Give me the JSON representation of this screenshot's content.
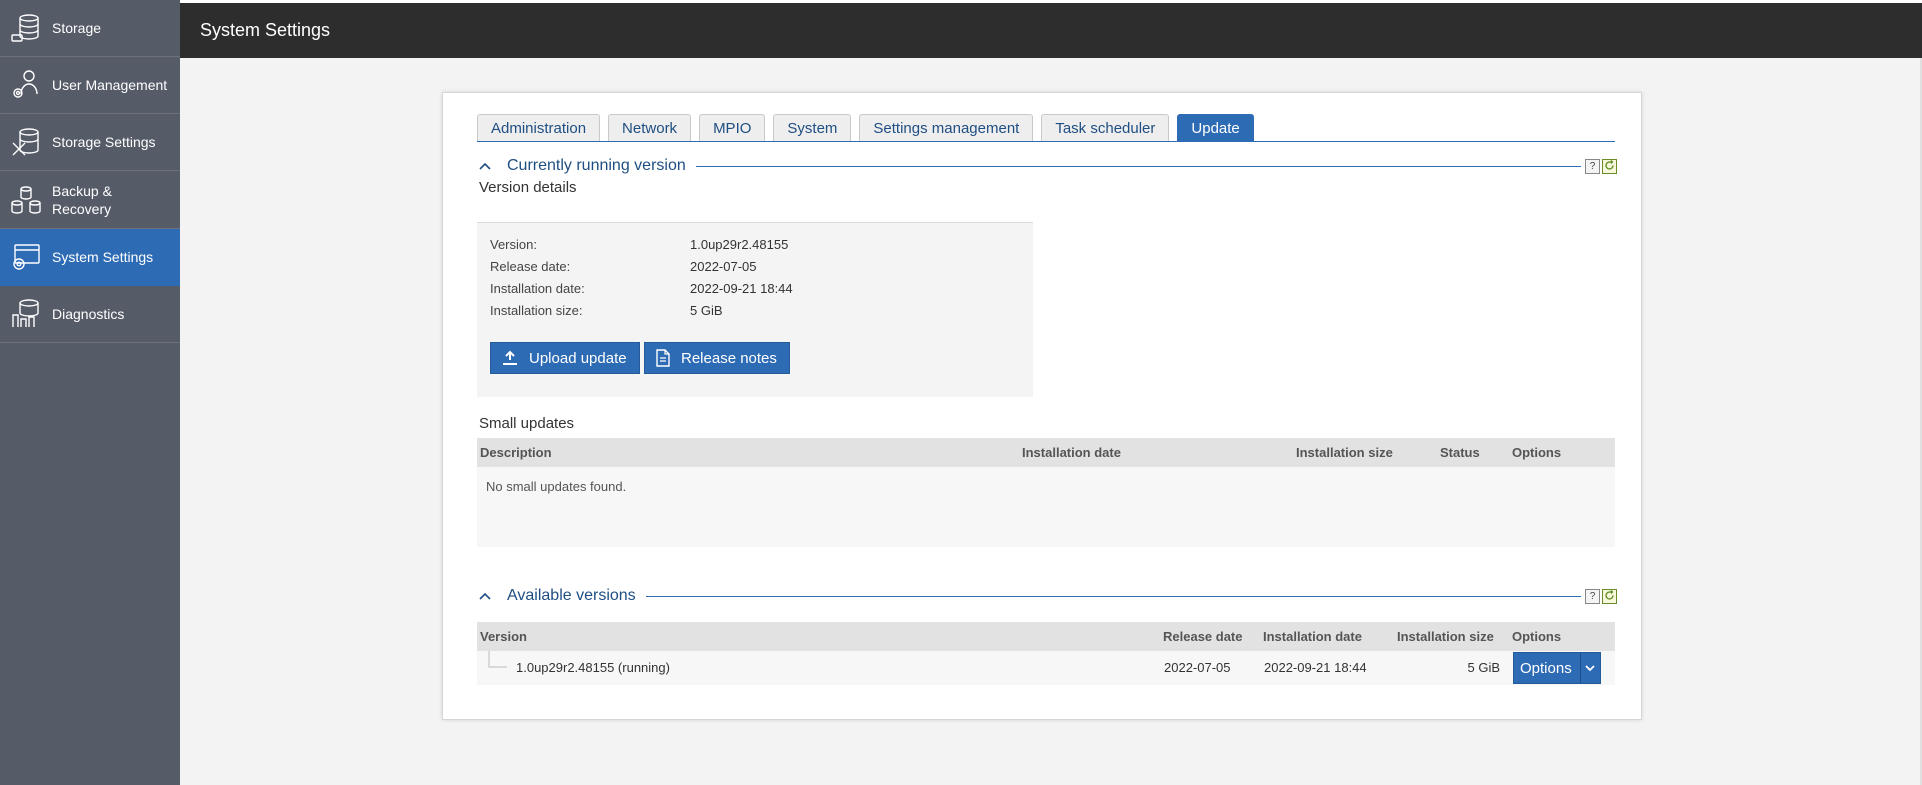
{
  "sidebar": {
    "items": [
      {
        "label": "Storage",
        "icon": "storage-icon"
      },
      {
        "label": "User Management",
        "icon": "user-management-icon"
      },
      {
        "label": "Storage Settings",
        "icon": "storage-settings-icon"
      },
      {
        "label": "Backup & Recovery",
        "icon": "backup-recovery-icon"
      },
      {
        "label": "System Settings",
        "icon": "system-settings-icon"
      },
      {
        "label": "Diagnostics",
        "icon": "diagnostics-icon"
      }
    ],
    "active": "System Settings"
  },
  "header": {
    "title": "System Settings"
  },
  "tabs": [
    {
      "label": "Administration"
    },
    {
      "label": "Network"
    },
    {
      "label": "MPIO"
    },
    {
      "label": "System"
    },
    {
      "label": "Settings management"
    },
    {
      "label": "Task scheduler"
    },
    {
      "label": "Update"
    }
  ],
  "active_tab": "Update",
  "current": {
    "title": "Currently running version",
    "details_heading": "Version details",
    "rows": [
      {
        "label": "Version:",
        "value": "1.0up29r2.48155"
      },
      {
        "label": "Release date:",
        "value": "2022-07-05"
      },
      {
        "label": "Installation date:",
        "value": "2022-09-21 18:44"
      },
      {
        "label": "Installation size:",
        "value": "5 GiB"
      }
    ],
    "upload_label": "Upload update",
    "release_notes_label": "Release notes"
  },
  "small_updates": {
    "heading": "Small updates",
    "columns": [
      "Description",
      "Installation date",
      "Installation size",
      "Status",
      "Options"
    ],
    "empty_text": "No small updates found."
  },
  "available": {
    "title": "Available versions",
    "columns": [
      "Version",
      "Release date",
      "Installation date",
      "Installation size",
      "Options"
    ],
    "rows": [
      {
        "version": "1.0up29r2.48155 (running)",
        "release_date": "2022-07-05",
        "install_date": "2022-09-21 18:44",
        "size": "5 GiB",
        "options_label": "Options"
      }
    ]
  },
  "help_glyph": "?",
  "colors": {
    "accent": "#2e6bb5",
    "sidebar": "#565b68",
    "topbar": "#2d2d2d"
  }
}
